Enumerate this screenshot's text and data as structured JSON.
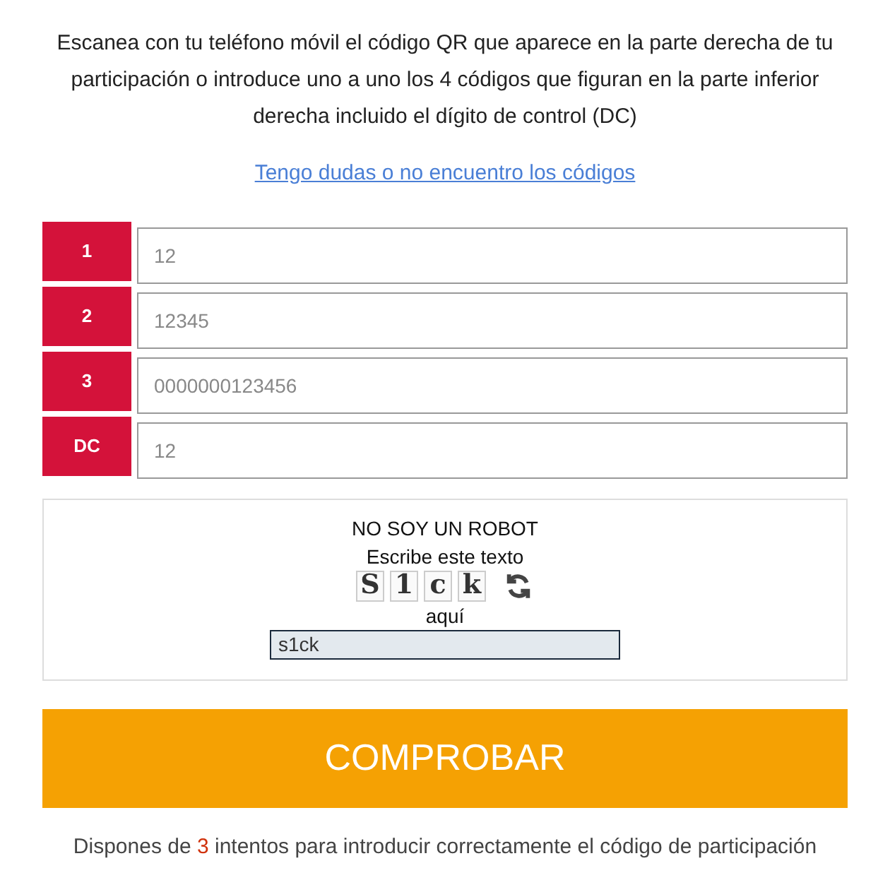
{
  "instructions": "Escanea con tu teléfono móvil el código QR que aparece en la parte derecha de tu participación o introduce uno a uno los 4 códigos que figuran en la parte inferior derecha incluido el dígito de control (DC)",
  "help_link": "Tengo dudas o no encuentro los códigos",
  "code_fields": [
    {
      "label": "1",
      "placeholder": "12"
    },
    {
      "label": "2",
      "placeholder": "12345"
    },
    {
      "label": "3",
      "placeholder": "0000000123456"
    },
    {
      "label": "DC",
      "placeholder": "12"
    }
  ],
  "captcha": {
    "title": "NO SOY UN ROBOT",
    "prompt": "Escribe este texto",
    "characters": [
      "S",
      "1",
      "c",
      "k"
    ],
    "after_label": "aquí",
    "value": "s1ck"
  },
  "submit_button": "COMPROBAR",
  "footer": {
    "text_before": "Dispones de",
    "attempts": "3",
    "text_after": "intentos para introducir correctamente el código de participación"
  }
}
